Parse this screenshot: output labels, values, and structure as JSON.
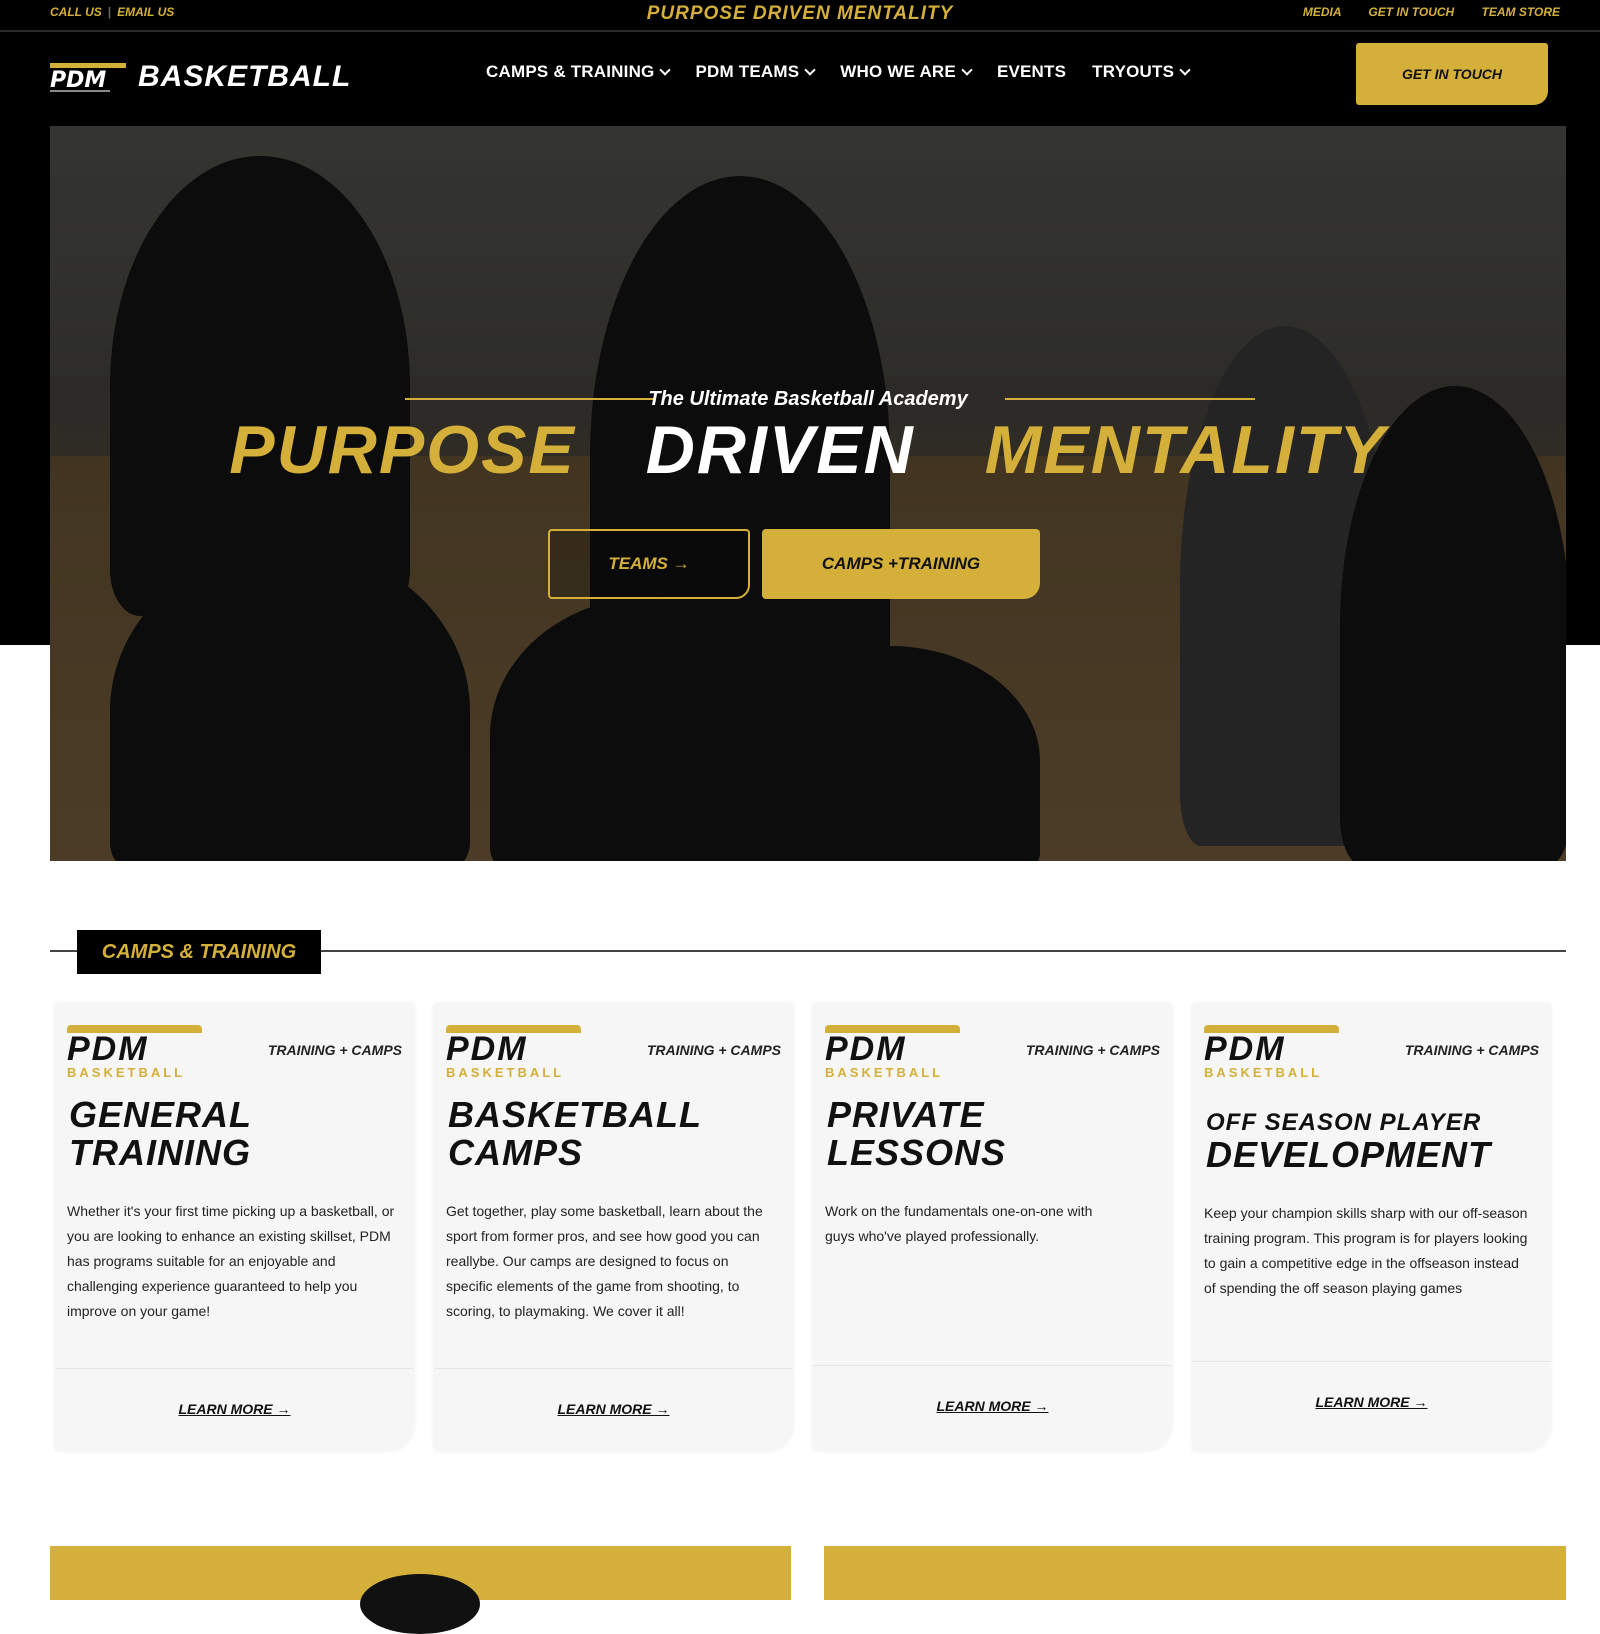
{
  "topbar": {
    "call": "CALL US",
    "email": "EMAIL US",
    "tagline": "PURPOSE DRIVEN MENTALITY",
    "links": [
      "MEDIA",
      "GET IN TOUCH",
      "TEAM STORE"
    ]
  },
  "nav": {
    "logo_text": "BASKETBALL",
    "items": [
      {
        "label": "CAMPS & TRAINING"
      },
      {
        "label": "PDM TEAMS"
      },
      {
        "label": "WHO WE ARE"
      },
      {
        "label": "EVENTS"
      },
      {
        "label": "TRYOUTS"
      }
    ],
    "cta": "GET IN TOUCH"
  },
  "hero": {
    "subtitle": "The Ultimate Basketball Academy",
    "headline": [
      "PURPOSE",
      "DRIVEN",
      "MENTALITY"
    ],
    "btn_teams": "TEAMS →",
    "btn_camps": "CAMPS +TRAINING"
  },
  "section": {
    "title": "CAMPS & TRAINING"
  },
  "cards": [
    {
      "logo_main": "PDM",
      "logo_sub": "BASKETBALL",
      "kicker": "TRAINING + CAMPS",
      "title_1": "GENERAL",
      "title_2": "TRAINING",
      "desc": "Whether it's your first time picking up a basketball, or you are looking to enhance an existing skillset, PDM has programs suitable for an enjoyable and challenging experience guaranteed to help you improve on your game!",
      "more": "LEARN MORE →"
    },
    {
      "logo_main": "PDM",
      "logo_sub": "BASKETBALL",
      "kicker": "TRAINING + CAMPS",
      "title_1": "BASKETBALL",
      "title_2": "CAMPS",
      "desc": "Get together, play some basketball, learn about the sport from former pros, and see how good you can reallybe. Our camps are designed to focus on specific elements of the game from shooting, to scoring, to playmaking. We cover it all!",
      "more": "LEARN MORE →"
    },
    {
      "logo_main": "PDM",
      "logo_sub": "BASKETBALL",
      "kicker": "TRAINING + CAMPS",
      "title_1": "PRIVATE",
      "title_2": "LESSONS",
      "desc": "Work on the fundamentals one-on-one with guys who've played professionally.",
      "more": "LEARN MORE →"
    },
    {
      "logo_main": "PDM",
      "logo_sub": "BASKETBALL",
      "kicker": "TRAINING + CAMPS",
      "title_1": "OFF SEASON PLAYER",
      "title_2": "DEVELOPMENT",
      "desc": "Keep your champion skills sharp with our off-season training program. This program is for players looking to gain a competitive edge in the offseason instead of spending the off season playing games",
      "more": "LEARN MORE →"
    }
  ],
  "colors": {
    "accent": "#d4b03a",
    "dark": "#000000",
    "card": "#f6f6f6"
  }
}
